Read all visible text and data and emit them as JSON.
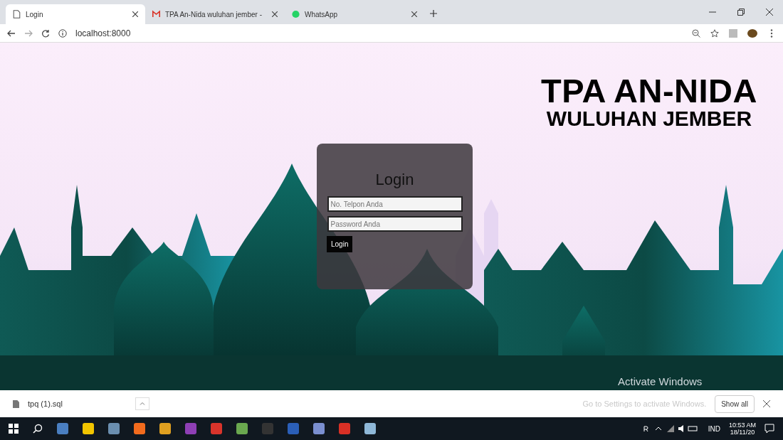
{
  "browser": {
    "tabs": [
      {
        "title": "Login",
        "selected": true,
        "kind": "page"
      },
      {
        "title": "TPA An-Nida wuluhan jember -",
        "selected": false,
        "kind": "mail"
      },
      {
        "title": "WhatsApp",
        "selected": false,
        "kind": "chat"
      }
    ],
    "address": "localhost:8000"
  },
  "page": {
    "heading": "TPA AN-NIDA",
    "subheading": "WULUHAN JEMBER",
    "login": {
      "title": "Login",
      "phone_placeholder": "No. Telpon Anda",
      "password_placeholder": "Password Anda",
      "button": "Login"
    }
  },
  "activation": {
    "title": "Activate Windows",
    "text": "Go to Settings to activate Windows."
  },
  "downloads": {
    "file": "tpq (1).sql",
    "button": "Show all"
  },
  "taskbar": {
    "language": "IND",
    "time": "10:53 AM",
    "date": "18/11/20"
  }
}
